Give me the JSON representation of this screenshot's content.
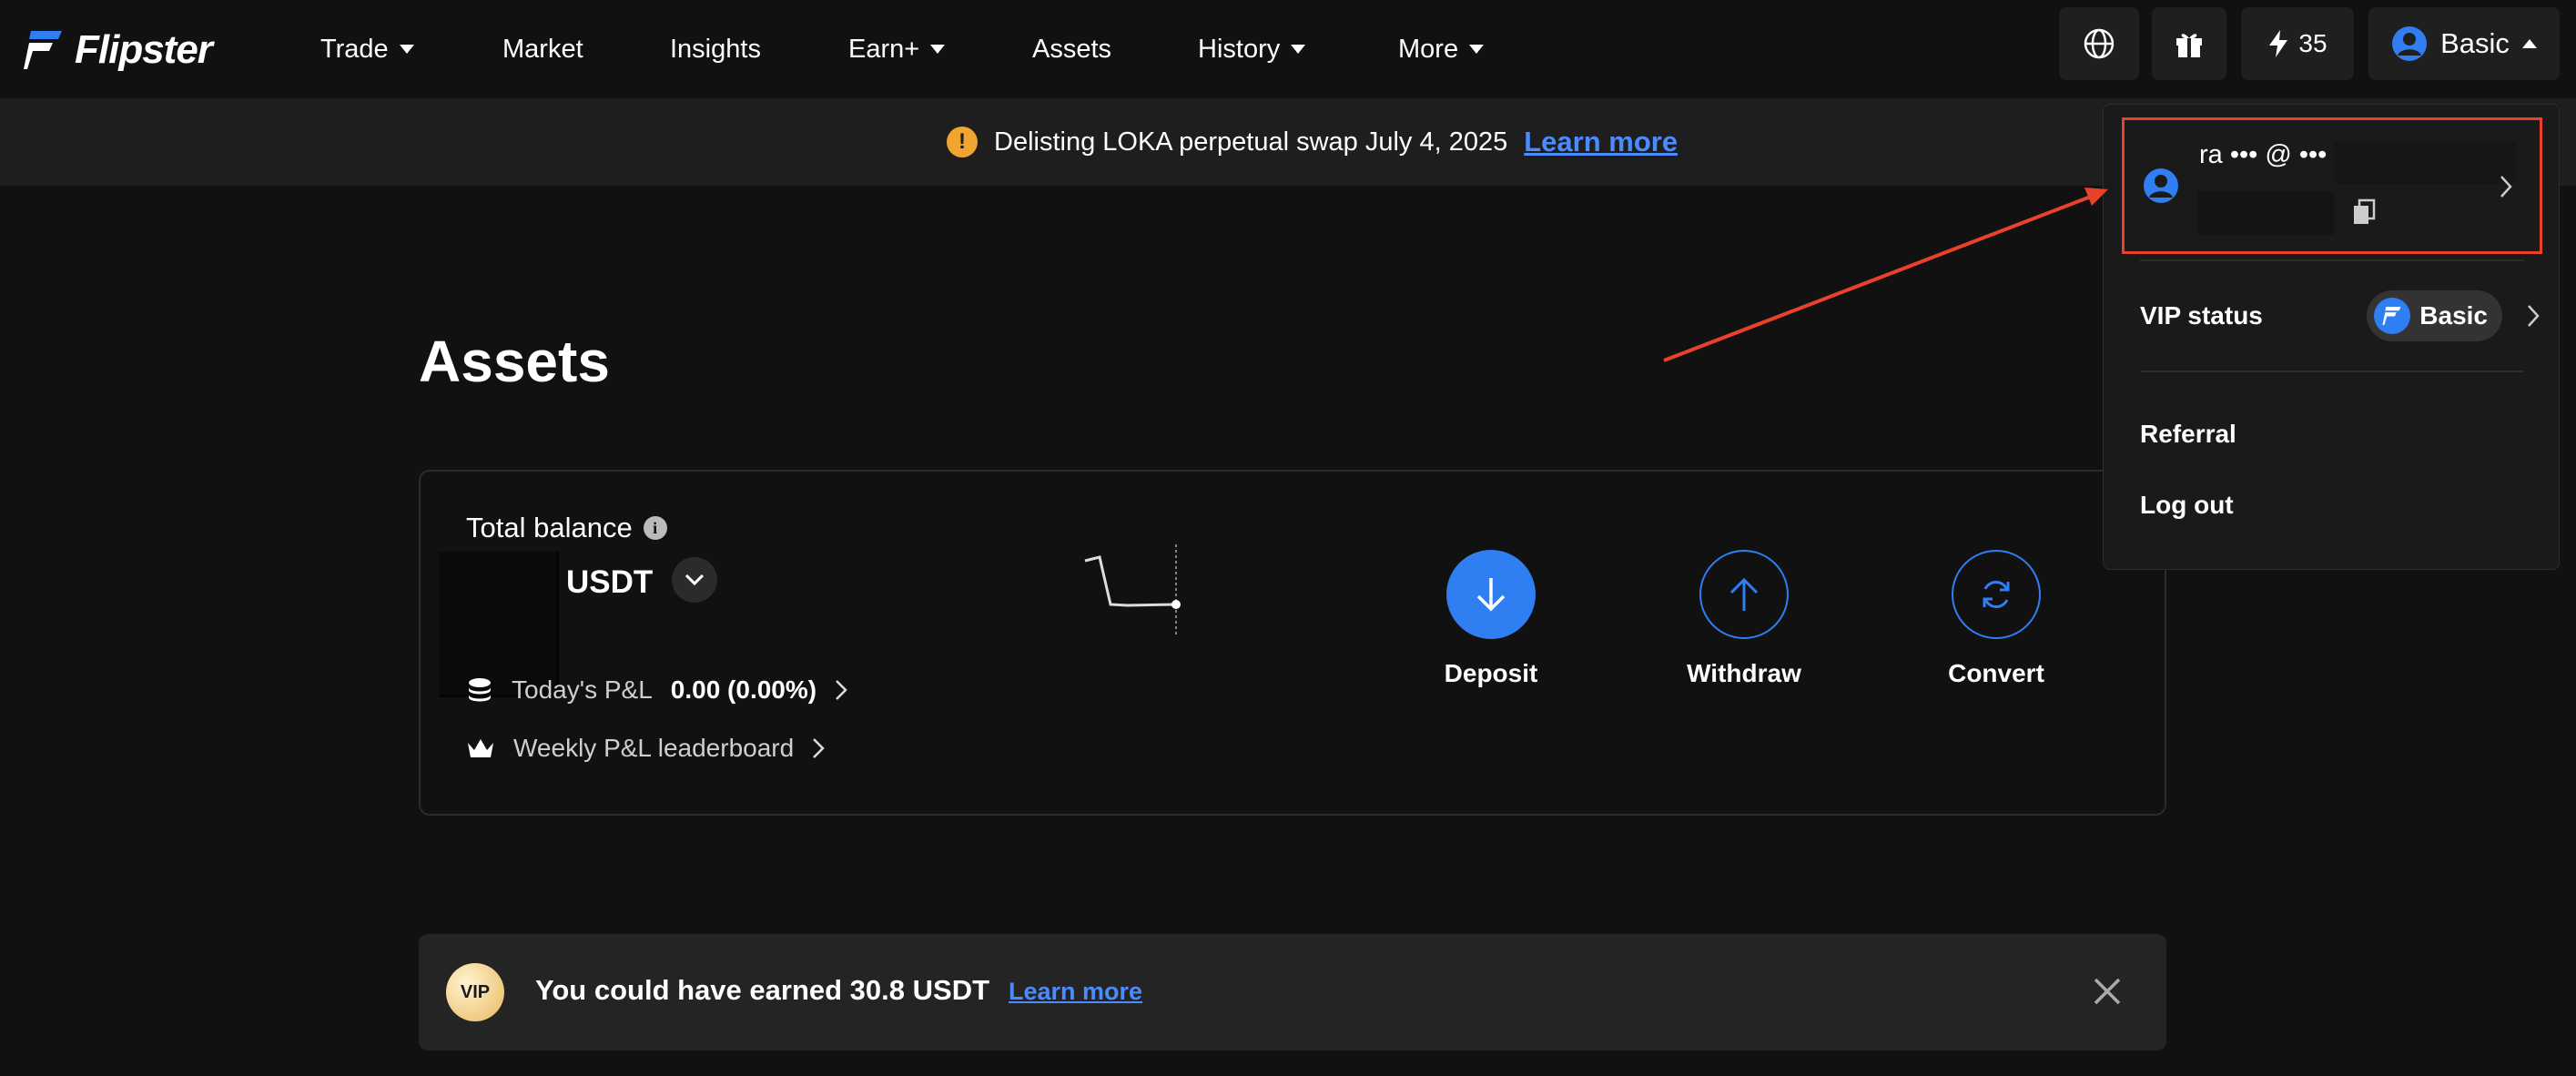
{
  "brand": {
    "name": "Flipster"
  },
  "nav": {
    "items": [
      {
        "label": "Trade",
        "has_caret": true
      },
      {
        "label": "Market",
        "has_caret": false
      },
      {
        "label": "Insights",
        "has_caret": false
      },
      {
        "label": "Earn+",
        "has_caret": true
      },
      {
        "label": "Assets",
        "has_caret": false
      },
      {
        "label": "History",
        "has_caret": true
      },
      {
        "label": "More",
        "has_caret": true
      }
    ],
    "globe_icon": "globe-icon",
    "gift_icon": "gift-icon",
    "points": "35",
    "account_label": "Basic"
  },
  "announcement": {
    "text": "Delisting LOKA perpetual swap July 4, 2025",
    "link": "Learn more"
  },
  "page": {
    "title": "Assets"
  },
  "balance": {
    "label": "Total balance",
    "currency": "USDT",
    "pnl_label": "Today's P&L",
    "pnl_value": "0.00 (0.00%)",
    "leaderboard_label": "Weekly P&L leaderboard"
  },
  "actions": {
    "deposit": "Deposit",
    "withdraw": "Withdraw",
    "convert": "Convert"
  },
  "vip_banner": {
    "badge": "VIP",
    "text": "You could have earned 30.8 USDT",
    "link": "Learn more"
  },
  "dropdown": {
    "user_email": "ra ••• @ •••",
    "vip_status_label": "VIP status",
    "vip_level": "Basic",
    "referral": "Referral",
    "logout": "Log out"
  },
  "colors": {
    "background": "#111111",
    "accent_blue": "#2f7ef2",
    "link_blue": "#4a8bff",
    "warning": "#f0a530",
    "highlight_red": "#e8422c"
  }
}
